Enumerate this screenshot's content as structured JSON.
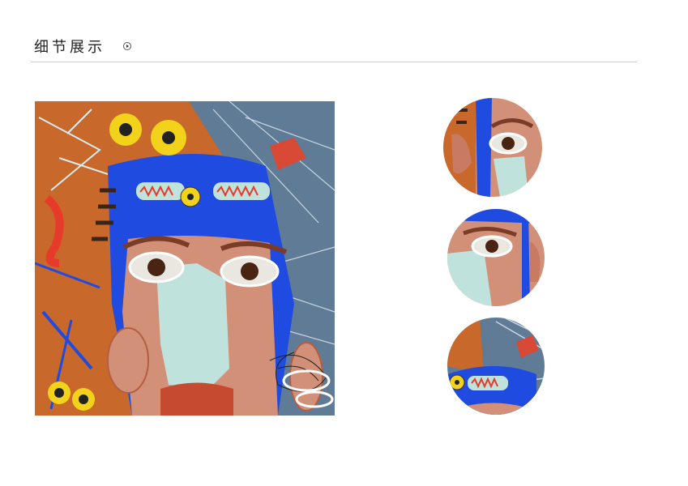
{
  "section": {
    "title": "细节展示",
    "arrow_icon": "circle-arrow-right-icon"
  },
  "painting": {
    "colors": {
      "orange": "#c8682a",
      "blue": "#1f4be0",
      "slate": "#5f7b96",
      "skin": "#d39078",
      "mint": "#bfe3dc",
      "lips": "#c64a2f",
      "yellow": "#f2d21a"
    }
  },
  "details": [
    {
      "name": "detail-eye-top"
    },
    {
      "name": "detail-eye-middle"
    },
    {
      "name": "detail-forehead-bottom"
    }
  ]
}
